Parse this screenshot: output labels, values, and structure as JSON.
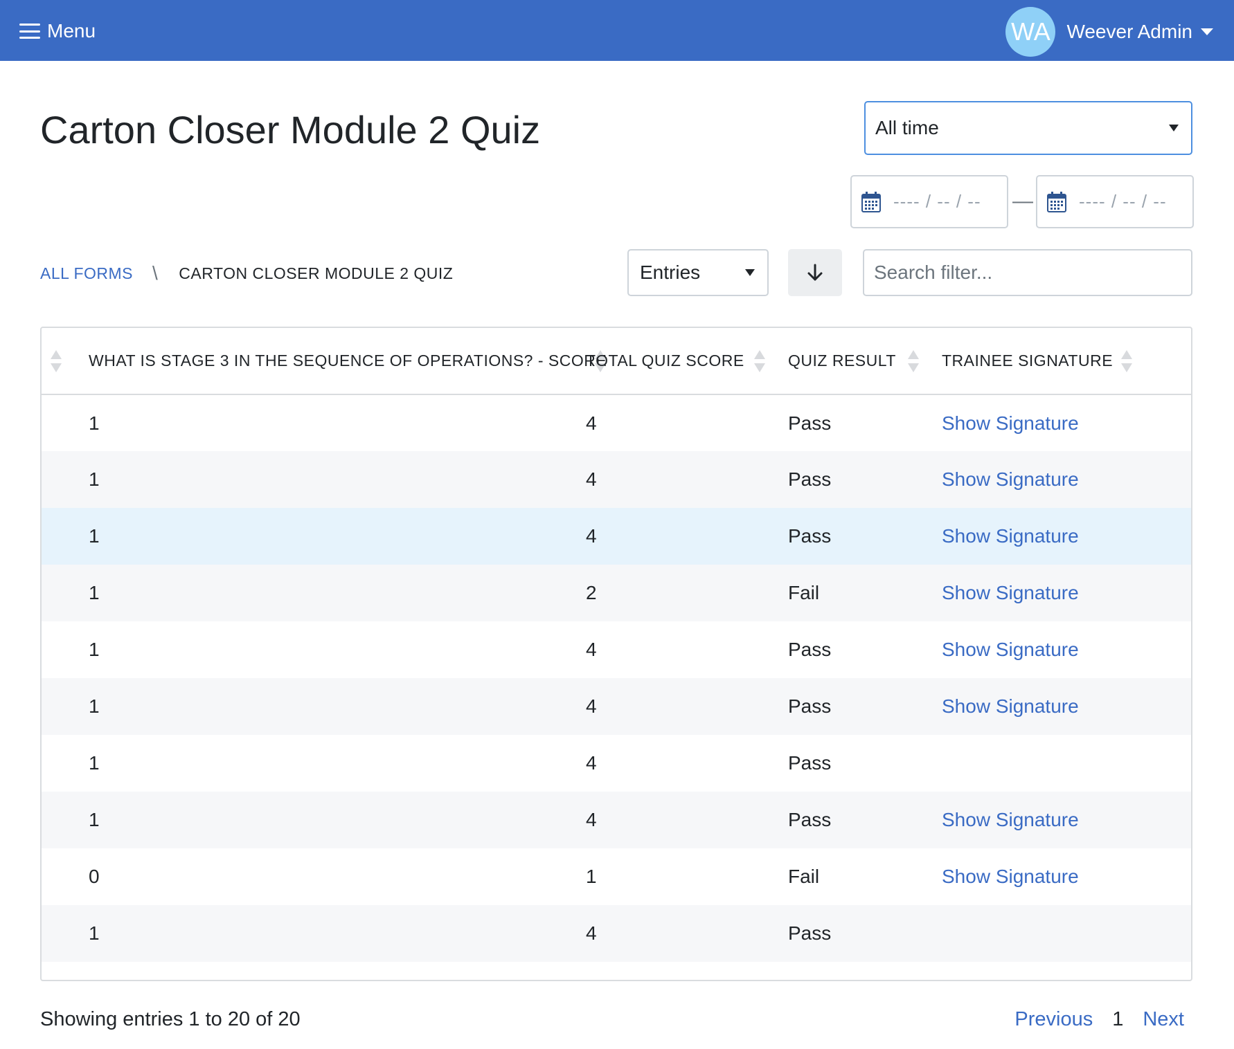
{
  "navbar": {
    "menu_label": "Menu",
    "user_initials": "WA",
    "user_name": "Weever Admin"
  },
  "page": {
    "title": "Carton Closer Module 2 Quiz"
  },
  "filters": {
    "time_range": "All time",
    "date_from_placeholder": "---- / -- / --",
    "date_to_placeholder": "---- / -- / --",
    "date_separator": "—",
    "view_mode": "Entries",
    "search_placeholder": "Search filter..."
  },
  "breadcrumb": {
    "root": "All Forms",
    "separator": "\\",
    "current": "Carton Closer Module 2 Quiz"
  },
  "table": {
    "columns": [
      "What is stage 3 in the sequence of operations? - Score",
      "Total Quiz Score",
      "Quiz Result",
      "Trainee Signature"
    ],
    "rows": [
      [
        "1",
        "4",
        "Pass",
        "Show Signature"
      ],
      [
        "1",
        "4",
        "Pass",
        "Show Signature"
      ],
      [
        "1",
        "4",
        "Pass",
        "Show Signature"
      ],
      [
        "1",
        "2",
        "Fail",
        "Show Signature"
      ],
      [
        "1",
        "4",
        "Pass",
        "Show Signature"
      ],
      [
        "1",
        "4",
        "Pass",
        "Show Signature"
      ],
      [
        "1",
        "4",
        "Pass",
        ""
      ],
      [
        "1",
        "4",
        "Pass",
        "Show Signature"
      ],
      [
        "0",
        "1",
        "Fail",
        "Show Signature"
      ],
      [
        "1",
        "4",
        "Pass",
        ""
      ]
    ]
  },
  "footer": {
    "showing_text": "Showing entries 1 to 20 of 20",
    "previous_label": "Previous",
    "current_page": "1",
    "next_label": "Next"
  },
  "colors": {
    "navbar": "#3a6bc4",
    "link": "#3a6bc4",
    "avatar": "#8fd0f7",
    "row_highlight": "#e6f3fc"
  }
}
